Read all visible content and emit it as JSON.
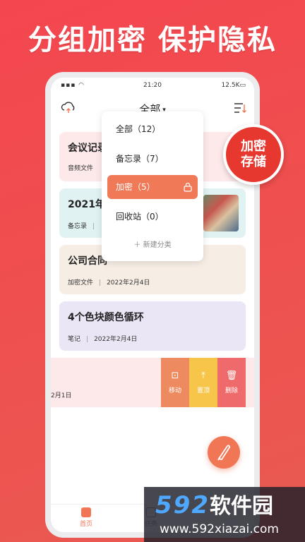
{
  "headline": "分组加密 保护隐私",
  "status_bar": {
    "time": "21:20",
    "left": "▪▪▪ ◠",
    "right": "12.5K▭"
  },
  "header": {
    "title": "全部",
    "caret": "▾"
  },
  "notes": [
    {
      "title": "会议记录",
      "category": "音频文件",
      "date": ""
    },
    {
      "title": "2021年纟",
      "category": "备忘录",
      "date": ""
    },
    {
      "title": "公司合同",
      "category": "加密文件",
      "date": "2022年2月4日"
    },
    {
      "title": "4个色块颜色循环",
      "category": "笔记",
      "date": "2022年2月4日"
    }
  ],
  "swipe_row": {
    "date_fragment": "2月1日",
    "actions": [
      {
        "glyph": "⊡",
        "label": "移动"
      },
      {
        "glyph": "⤒",
        "label": "置顶"
      },
      {
        "glyph": "🗑",
        "label": "删除"
      }
    ]
  },
  "dropdown": {
    "items": [
      {
        "label": "全部（12）"
      },
      {
        "label": "备忘录（7）"
      },
      {
        "label": "加密（5）"
      },
      {
        "label": "回收站（0）"
      }
    ],
    "new_category": "＋ 新建分类"
  },
  "badge": {
    "line1": "加密",
    "line2": "存储"
  },
  "tabbar": {
    "home": "首页",
    "task": "任务"
  },
  "watermark": {
    "logo_num": "592",
    "logo_cn": "软件园",
    "url": "www.592xiazai.com"
  },
  "colors": {
    "accent": "#f07656",
    "background": "#f4464f",
    "badge": "#e7382f"
  }
}
